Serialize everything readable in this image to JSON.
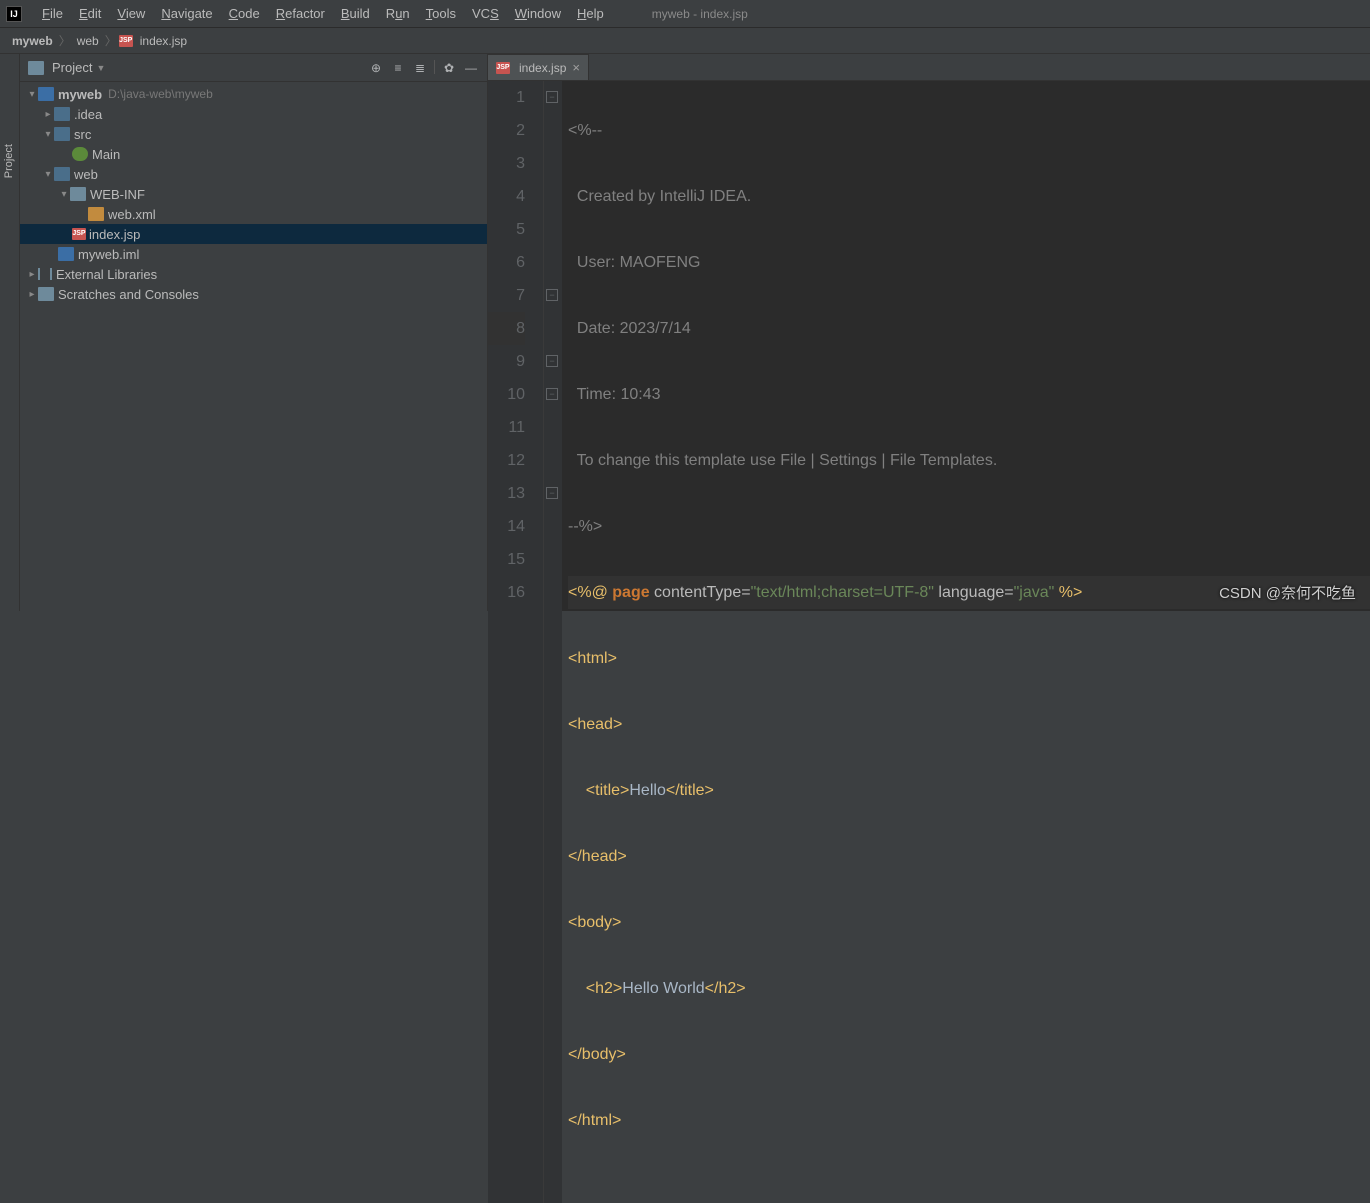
{
  "window_title": "myweb - index.jsp",
  "menu": [
    "File",
    "Edit",
    "View",
    "Navigate",
    "Code",
    "Refactor",
    "Build",
    "Run",
    "Tools",
    "VCS",
    "Window",
    "Help"
  ],
  "breadcrumb": [
    "myweb",
    "web",
    "index.jsp"
  ],
  "project_panel": {
    "title": "Project",
    "root": {
      "name": "myweb",
      "path": "D:\\java-web\\myweb"
    },
    "items": [
      {
        "name": ".idea"
      },
      {
        "name": "src"
      },
      {
        "name": "Main"
      },
      {
        "name": "web"
      },
      {
        "name": "WEB-INF"
      },
      {
        "name": "web.xml"
      },
      {
        "name": "index.jsp"
      },
      {
        "name": "myweb.iml"
      },
      {
        "name": "External Libraries"
      },
      {
        "name": "Scratches and Consoles"
      }
    ]
  },
  "sidebar_label": "Project",
  "tab": {
    "name": "index.jsp"
  },
  "code": {
    "lines": [
      "1",
      "2",
      "3",
      "4",
      "5",
      "6",
      "7",
      "8",
      "9",
      "10",
      "11",
      "12",
      "13",
      "14",
      "15",
      "16"
    ],
    "comment_open": "<%--",
    "c2": "  Created by IntelliJ IDEA.",
    "c3": "  User: MAOFENG",
    "c4": "  Date: 2023/7/14",
    "c5": "  Time: 10:43",
    "c6": "  To change this template use File | Settings | File Templates.",
    "comment_close": "--%>",
    "directive_open": "<%@ ",
    "kw_page": "page",
    "attr_ct": " contentType=",
    "val_ct": "\"text/html;charset=UTF-8\"",
    "attr_lang": " language=",
    "val_lang": "\"java\"",
    "directive_close": " %>",
    "t_html_o": "<html>",
    "t_head_o": "<head>",
    "t_title_o": "    <title>",
    "title_text": "Hello",
    "t_title_c": "</title>",
    "t_head_c": "</head>",
    "t_body_o": "<body>",
    "t_h2_o": "    <h2>",
    "h2_text": "Hello World",
    "t_h2_c": "</h2>",
    "t_body_c": "</body>",
    "t_html_c": "</html>"
  },
  "watermark": "CSDN @奈何不吃鱼"
}
